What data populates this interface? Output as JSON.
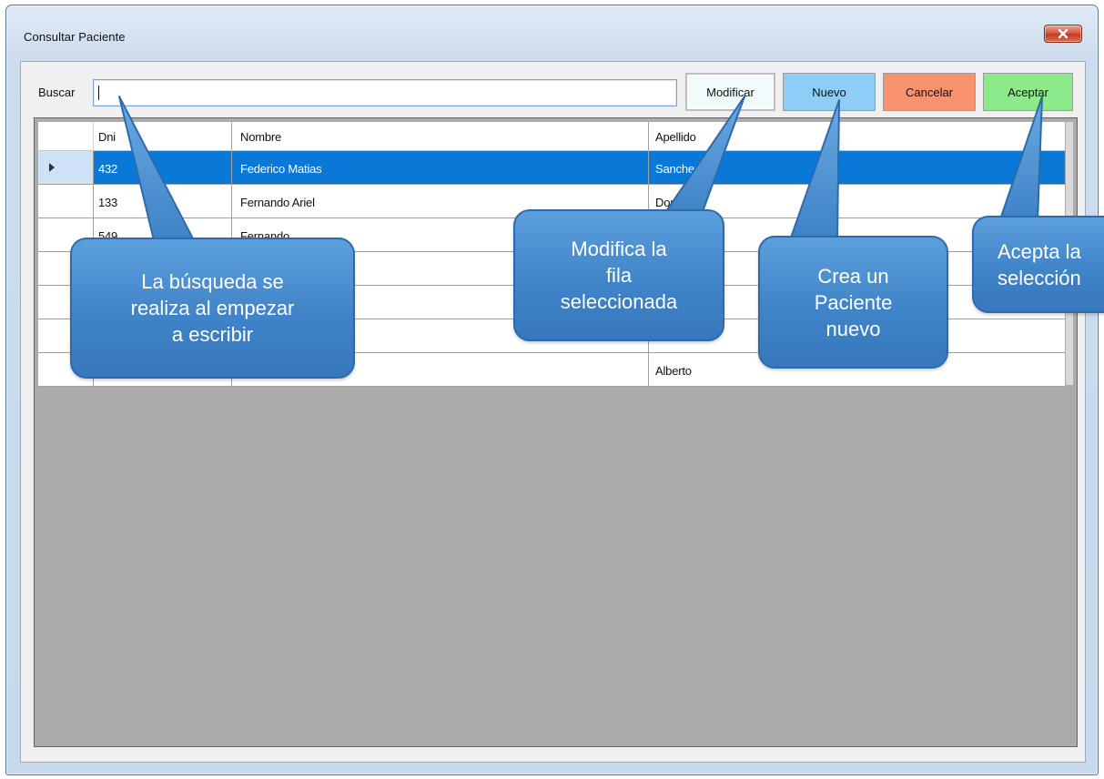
{
  "window": {
    "title": "Consultar Paciente",
    "close_label": "✕"
  },
  "search": {
    "label": "Buscar",
    "value": "",
    "placeholder": ""
  },
  "buttons": {
    "modificar": "Modificar",
    "nuevo": "Nuevo",
    "cancelar": "Cancelar",
    "aceptar": "Aceptar"
  },
  "grid": {
    "columns": [
      "Dni",
      "Nombre",
      "Apellido"
    ],
    "rows": [
      {
        "dni": "432",
        "nombre": "Federico Matias",
        "apellido": "Sanchez",
        "selected": true
      },
      {
        "dni": "133",
        "nombre": "Fernando Ariel",
        "apellido": "Donato",
        "selected": false
      },
      {
        "dni": "549",
        "nombre": "Fernando",
        "apellido": "",
        "selected": false
      },
      {
        "dni": "",
        "nombre": "",
        "apellido": "",
        "selected": false
      },
      {
        "dni": "",
        "nombre": "",
        "apellido": "",
        "selected": false
      },
      {
        "dni": "",
        "nombre": "",
        "apellido": "",
        "selected": false
      },
      {
        "dni": "",
        "nombre": "",
        "apellido": "Alberto",
        "selected": false
      }
    ]
  },
  "callouts": {
    "busqueda": "La búsqueda se\nrealiza al empezar\na escribir",
    "modifica": "Modifica la\nfila\nseleccionada",
    "crea": "Crea un\nPaciente\nnuevo",
    "acepta": "Acepta la\nselección"
  },
  "colors": {
    "selected_row": "#0a78d6",
    "nuevo": "#8ecdf6",
    "cancelar": "#f9926e",
    "aceptar": "#8cea8a",
    "callout": "#3e82c7"
  }
}
